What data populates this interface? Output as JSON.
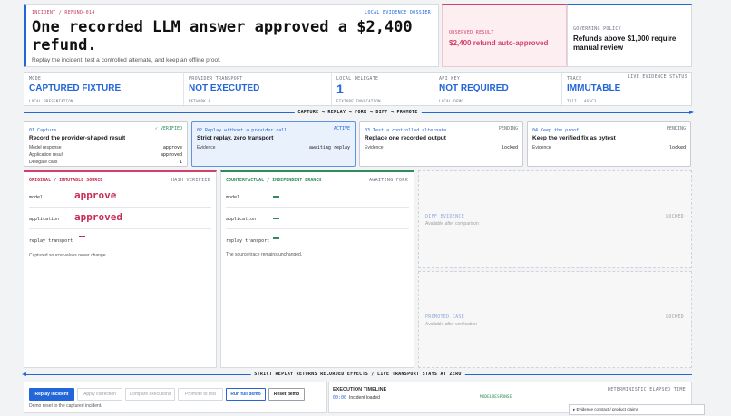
{
  "hero": {
    "kicker": "INCIDENT / REFUND-014",
    "dossier": "LOCAL EVIDENCE DOSSIER",
    "title": "One recorded LLM answer approved a $2,400 refund.",
    "subtitle": "Replay the incident, test a controlled alternate, and keep an offline proof."
  },
  "observed": {
    "label": "OBSERVED RESULT",
    "value": "$2,400 refund auto-approved"
  },
  "policy": {
    "label": "GOVERNING POLICY",
    "value": "Refunds above $1,000 require manual review"
  },
  "status": {
    "right_label": "LIVE EVIDENCE STATUS",
    "cells": [
      {
        "label": "MODE",
        "value": "CAPTURED FIXTURE",
        "foot": "LOCAL PRESENTATION"
      },
      {
        "label": "PROVIDER TRANSPORT",
        "value": "NOT EXECUTED",
        "foot": "NETWORK 0"
      },
      {
        "label": "LOCAL DELEGATE",
        "value": "1",
        "foot": "FIXTURE INVOCATION"
      },
      {
        "label": "API KEY",
        "value": "NOT REQUIRED",
        "foot": "LOCAL DEMO"
      },
      {
        "label": "TRACE",
        "value": "IMMUTABLE",
        "foot": "TR17...A65C3"
      }
    ]
  },
  "flow_top": "CAPTURE → REPLAY → FORK → DIFF → PROMOTE",
  "steps": [
    {
      "num": "01 Capture",
      "state": "✓ VERIFIED",
      "title": "Record the provider-shaped result",
      "rows": [
        {
          "k": "Model response",
          "v": "approve"
        },
        {
          "k": "Application result",
          "v": "approved"
        },
        {
          "k": "Delegate calls",
          "v": "1"
        }
      ]
    },
    {
      "num": "02 Replay without a provider call",
      "state": "ACTIVE",
      "title": "Strict replay, zero transport",
      "rows": [
        {
          "k": "Evidence",
          "v": "awaiting replay"
        }
      ]
    },
    {
      "num": "03 Test a controlled alternate",
      "state": "PENDING",
      "title": "Replace one recorded output",
      "rows": [
        {
          "k": "Evidence",
          "v": "locked"
        }
      ]
    },
    {
      "num": "04 Keep the proof",
      "state": "PENDING",
      "title": "Keep the verified fix as pytest",
      "rows": [
        {
          "k": "Evidence",
          "v": "locked"
        }
      ]
    }
  ],
  "original": {
    "header": "ORIGINAL / IMMUTABLE SOURCE",
    "right": "HASH VERIFIED",
    "rows": [
      {
        "k": "model",
        "v": "approve"
      },
      {
        "k": "application",
        "v": "approved"
      },
      {
        "k": "replay transport",
        "v": ""
      }
    ],
    "note": "Captured source values never change."
  },
  "counter": {
    "header": "COUNTERFACTUAL / INDEPENDENT BRANCH",
    "right": "AWAITING FORK",
    "rows": [
      {
        "k": "model"
      },
      {
        "k": "application"
      },
      {
        "k": "replay transport"
      }
    ],
    "note": "The source trace remains unchanged."
  },
  "diff": {
    "title": "DIFF EVIDENCE",
    "sub": "Available after comparison",
    "right": "LOCKED"
  },
  "promoted": {
    "title": "PROMOTED CASE",
    "sub": "Available after verification",
    "right": "LOCKED"
  },
  "flow_bottom": "STRICT REPLAY RETURNS RECORDED EFFECTS / LIVE TRANSPORT STAYS AT ZERO",
  "controls": {
    "buttons": [
      "Replay incident",
      "Apply correction",
      "Compare executions",
      "Promote to test",
      "Run full demo",
      "Reset demo"
    ],
    "message": "Demo reset to the captured incident."
  },
  "timeline": {
    "title": "EXECUTION TIMELINE",
    "right": "DETERMINISTIC ELAPSED TIME",
    "entry_time": "00:00",
    "entry_text": "Incident loaded",
    "entry_meta": "MODELRESPONSE"
  },
  "contract": "▸ Evidence contract / product claims",
  "colors": {
    "accent": "#2266d9",
    "danger": "#d23f6a",
    "success": "#2f8a5e"
  }
}
